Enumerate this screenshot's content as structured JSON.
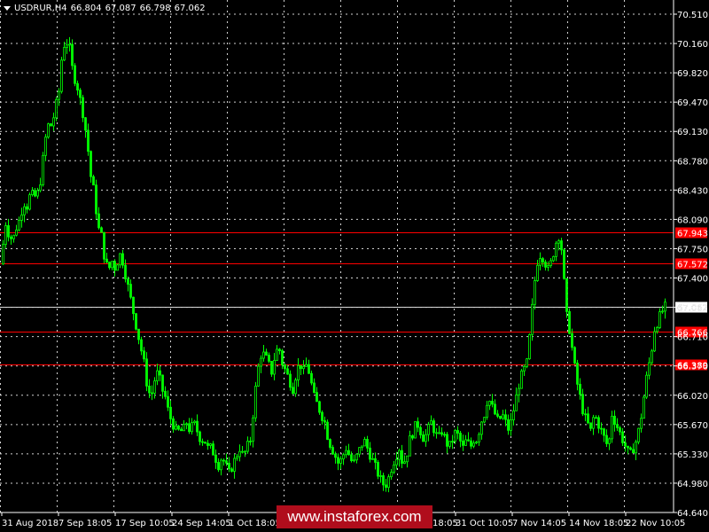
{
  "header": {
    "symbol": "USDRUR,H4",
    "open": "66.804",
    "high": "67.087",
    "low": "66.798",
    "close": "67.062"
  },
  "watermark": "www.instaforex.com",
  "colors": {
    "background": "#000000",
    "grid": "#d0d0d0",
    "bull_candle": "#00ff00",
    "level_line": "#ff0000",
    "level_label_bg": "#ff0000",
    "price_line": "#d8d8d8",
    "axis_text": "#ffffff"
  },
  "chart_data": {
    "type": "candlestick",
    "symbol": "USDRUR",
    "timeframe": "H4",
    "ylim": [
      64.64,
      70.51
    ],
    "y_ticks": [
      "70.510",
      "70.160",
      "69.820",
      "69.470",
      "69.130",
      "68.780",
      "68.430",
      "68.090",
      "67.750",
      "67.400",
      "67.062",
      "66.710",
      "66.370",
      "66.020",
      "65.670",
      "65.330",
      "64.980",
      "64.640"
    ],
    "x_labels": [
      "31 Aug 2018",
      "7 Sep 18:05",
      "17 Sep 10:05",
      "24 Sep 14:05",
      "1 Oct 18:05",
      "",
      "",
      "31 Oct 10:05",
      "7 Nov 14:05",
      "14 Nov 18:05",
      "22 Nov 10:05"
    ],
    "levels": [
      {
        "price": 67.943,
        "label": "67.943"
      },
      {
        "price": 67.572,
        "label": "67.572"
      },
      {
        "price": 66.766,
        "label": "66.766"
      },
      {
        "price": 66.389,
        "label": "66.389"
      }
    ],
    "current_price": {
      "price": 67.062,
      "label": "67.062"
    },
    "price_path": [
      [
        0,
        67.1
      ],
      [
        3,
        67.8
      ],
      [
        6,
        68.05
      ],
      [
        10,
        67.9
      ],
      [
        14,
        67.85
      ],
      [
        18,
        68.0
      ],
      [
        22,
        68.1
      ],
      [
        26,
        68.3
      ],
      [
        30,
        68.25
      ],
      [
        34,
        68.4
      ],
      [
        38,
        68.35
      ],
      [
        42,
        68.4
      ],
      [
        46,
        68.6
      ],
      [
        50,
        69.0
      ],
      [
        54,
        69.2
      ],
      [
        58,
        69.2
      ],
      [
        62,
        69.4
      ],
      [
        66,
        69.6
      ],
      [
        70,
        70.1
      ],
      [
        74,
        70.2
      ],
      [
        78,
        70.1
      ],
      [
        82,
        69.8
      ],
      [
        86,
        69.7
      ],
      [
        90,
        69.5
      ],
      [
        94,
        69.3
      ],
      [
        98,
        69.0
      ],
      [
        102,
        68.6
      ],
      [
        106,
        68.4
      ],
      [
        110,
        68.0
      ],
      [
        114,
        67.9
      ],
      [
        118,
        67.6
      ],
      [
        122,
        67.5
      ],
      [
        126,
        67.6
      ],
      [
        130,
        67.5
      ],
      [
        134,
        67.7
      ],
      [
        138,
        67.6
      ],
      [
        142,
        67.4
      ],
      [
        146,
        67.2
      ],
      [
        150,
        67.0
      ],
      [
        154,
        66.8
      ],
      [
        158,
        66.6
      ],
      [
        162,
        66.4
      ],
      [
        166,
        66.1
      ],
      [
        170,
        66.0
      ],
      [
        174,
        66.2
      ],
      [
        178,
        66.3
      ],
      [
        182,
        66.1
      ],
      [
        186,
        66.0
      ],
      [
        190,
        65.8
      ],
      [
        194,
        65.7
      ],
      [
        198,
        65.6
      ],
      [
        202,
        65.6
      ],
      [
        206,
        65.6
      ],
      [
        210,
        65.7
      ],
      [
        214,
        65.6
      ],
      [
        218,
        65.7
      ],
      [
        222,
        65.6
      ],
      [
        226,
        65.5
      ],
      [
        230,
        65.5
      ],
      [
        234,
        65.4
      ],
      [
        238,
        65.4
      ],
      [
        242,
        65.3
      ],
      [
        246,
        65.2
      ],
      [
        250,
        65.3
      ],
      [
        254,
        65.2
      ],
      [
        258,
        65.1
      ],
      [
        262,
        65.2
      ],
      [
        266,
        65.3
      ],
      [
        270,
        65.4
      ],
      [
        274,
        65.3
      ],
      [
        278,
        65.4
      ],
      [
        282,
        65.5
      ],
      [
        286,
        65.9
      ],
      [
        290,
        66.3
      ],
      [
        294,
        66.5
      ],
      [
        298,
        66.5
      ],
      [
        302,
        66.4
      ],
      [
        306,
        66.3
      ],
      [
        310,
        66.5
      ],
      [
        314,
        66.6
      ],
      [
        318,
        66.4
      ],
      [
        322,
        66.3
      ],
      [
        326,
        66.2
      ],
      [
        330,
        66.1
      ],
      [
        334,
        66.3
      ],
      [
        338,
        66.4
      ],
      [
        342,
        66.3
      ],
      [
        346,
        66.4
      ],
      [
        350,
        66.2
      ],
      [
        354,
        66.0
      ],
      [
        358,
        65.9
      ],
      [
        362,
        65.8
      ],
      [
        366,
        65.7
      ],
      [
        370,
        65.5
      ],
      [
        374,
        65.4
      ],
      [
        378,
        65.3
      ],
      [
        382,
        65.2
      ],
      [
        386,
        65.3
      ],
      [
        390,
        65.4
      ],
      [
        394,
        65.3
      ],
      [
        398,
        65.2
      ],
      [
        402,
        65.3
      ],
      [
        406,
        65.4
      ],
      [
        410,
        65.5
      ],
      [
        414,
        65.4
      ],
      [
        418,
        65.3
      ],
      [
        422,
        65.2
      ],
      [
        426,
        65.1
      ],
      [
        430,
        65.0
      ],
      [
        434,
        64.95
      ],
      [
        438,
        65.05
      ],
      [
        442,
        65.2
      ],
      [
        446,
        65.3
      ],
      [
        450,
        65.4
      ],
      [
        454,
        65.2
      ],
      [
        458,
        65.3
      ],
      [
        462,
        65.5
      ],
      [
        466,
        65.6
      ],
      [
        470,
        65.7
      ],
      [
        474,
        65.6
      ],
      [
        478,
        65.5
      ],
      [
        482,
        65.6
      ],
      [
        486,
        65.7
      ],
      [
        490,
        65.6
      ],
      [
        494,
        65.5
      ],
      [
        498,
        65.6
      ],
      [
        502,
        65.5
      ],
      [
        506,
        65.4
      ],
      [
        510,
        65.5
      ],
      [
        514,
        65.6
      ],
      [
        518,
        65.5
      ],
      [
        522,
        65.4
      ],
      [
        526,
        65.5
      ],
      [
        530,
        65.4
      ],
      [
        534,
        65.5
      ],
      [
        538,
        65.5
      ],
      [
        542,
        65.7
      ],
      [
        546,
        65.8
      ],
      [
        550,
        66.0
      ],
      [
        554,
        65.9
      ],
      [
        558,
        65.8
      ],
      [
        562,
        65.7
      ],
      [
        566,
        65.8
      ],
      [
        570,
        65.7
      ],
      [
        574,
        65.6
      ],
      [
        578,
        65.8
      ],
      [
        582,
        66.0
      ],
      [
        586,
        66.2
      ],
      [
        590,
        66.3
      ],
      [
        594,
        66.4
      ],
      [
        598,
        66.8
      ],
      [
        602,
        67.3
      ],
      [
        606,
        67.6
      ],
      [
        610,
        67.7
      ],
      [
        614,
        67.6
      ],
      [
        618,
        67.5
      ],
      [
        622,
        67.6
      ],
      [
        626,
        67.8
      ],
      [
        630,
        67.9
      ],
      [
        634,
        67.7
      ],
      [
        638,
        67.0
      ],
      [
        642,
        66.8
      ],
      [
        646,
        66.5
      ],
      [
        650,
        66.2
      ],
      [
        654,
        66.0
      ],
      [
        658,
        65.8
      ],
      [
        662,
        65.7
      ],
      [
        666,
        65.6
      ],
      [
        670,
        65.8
      ],
      [
        674,
        65.7
      ],
      [
        678,
        65.6
      ],
      [
        682,
        65.5
      ],
      [
        686,
        65.4
      ],
      [
        690,
        65.8
      ],
      [
        694,
        65.7
      ],
      [
        698,
        65.6
      ],
      [
        702,
        65.5
      ],
      [
        706,
        65.4
      ],
      [
        710,
        65.3
      ],
      [
        714,
        65.4
      ],
      [
        718,
        65.5
      ],
      [
        722,
        65.7
      ],
      [
        726,
        66.0
      ],
      [
        730,
        66.3
      ],
      [
        734,
        66.5
      ],
      [
        738,
        66.8
      ],
      [
        742,
        66.9
      ],
      [
        746,
        67.0
      ],
      [
        750,
        67.06
      ],
      [
        752,
        67.06
      ]
    ]
  }
}
